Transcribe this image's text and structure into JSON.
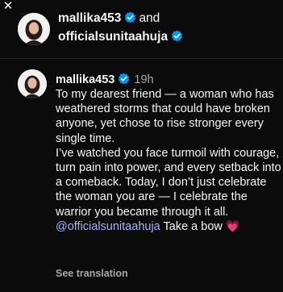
{
  "header": {
    "user1": "mallika453",
    "connector": "and",
    "user2": "officialsunitaahuja"
  },
  "post": {
    "username": "mallika453",
    "time": "19h",
    "caption_para1": "To my dearest friend — a woman who has weathered storms that could have broken anyone, yet chose to rise stronger every single time.",
    "caption_para2": "I’ve watched you face turmoil with courage, turn pain into power, and every setback into a comeback. Today, I don’t just celebrate the woman you are — I celebrate the warrior you became through it all.",
    "mention": "@officialsunitaahuja",
    "mention_suffix": "Take a bow",
    "heart_emoji": "💗",
    "see_translation": "See translation"
  },
  "colors": {
    "background": "#0b0b0b",
    "text": "#f5f5f5",
    "secondary_text": "#a8a8a8",
    "verified_badge": "#0095f6",
    "mention": "#a3b6ff",
    "heart": "#ff4b82"
  },
  "icons": {
    "close": "close-icon",
    "verified": "verified-badge-icon"
  }
}
